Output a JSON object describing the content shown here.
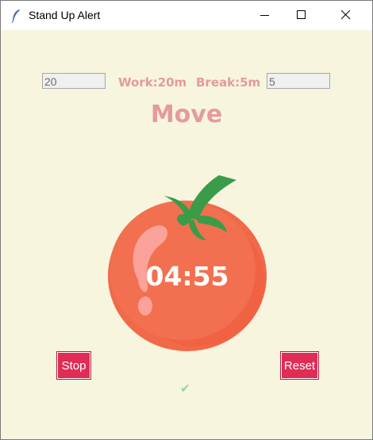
{
  "window": {
    "title": "Stand Up Alert",
    "icon": "feather-icon",
    "controls": [
      "minimize-icon",
      "maximize-icon",
      "close-icon"
    ]
  },
  "settings": {
    "work_minutes_value": "20",
    "work_label": "Work:20m",
    "break_label": "Break:5m",
    "break_minutes_value": "5"
  },
  "mode_label": "Move",
  "timer": {
    "time_remaining": "04:55"
  },
  "buttons": {
    "stop_label": "Stop",
    "reset_label": "Reset"
  },
  "status": {
    "checkmark": "✔"
  },
  "colors": {
    "background": "#f7f5de",
    "accent_text": "#e59a9b",
    "button_bg": "#df2d55",
    "tomato": "#f06a4a",
    "leaf": "#3a9b48",
    "check": "#8fd4a9"
  }
}
